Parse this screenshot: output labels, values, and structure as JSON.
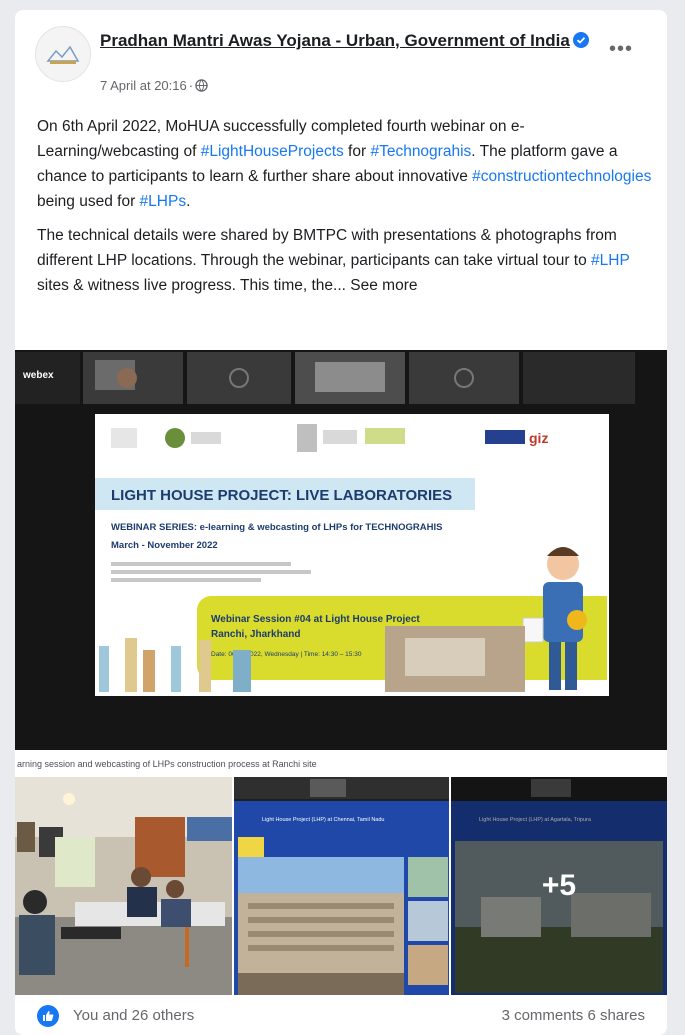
{
  "post": {
    "page_name": "Pradhan Mantri Awas Yojana - Urban, Government of India",
    "timestamp": "7 April at 20:16",
    "paragraphs": [
      [
        {
          "t": "On 6th April 2022, MoHUA successfully completed fourth webinar on e-Learning/webcasting of ",
          "tag": false
        },
        {
          "t": "#LightHouseProjects",
          "tag": true
        },
        {
          "t": " for ",
          "tag": false
        },
        {
          "t": "#Technograhis",
          "tag": true
        },
        {
          "t": ". The platform gave a chance to participants to learn & further share about innovative ",
          "tag": false
        },
        {
          "t": "#constructiontechnologies",
          "tag": true
        },
        {
          "t": " being used for ",
          "tag": false
        },
        {
          "t": "#LHPs",
          "tag": true
        },
        {
          "t": ".",
          "tag": false
        }
      ],
      [
        {
          "t": "The technical details were shared by BMTPC with presentations & photographs from different LHP locations. Through the webinar, participants can take virtual tour to ",
          "tag": false
        },
        {
          "t": "#LHP",
          "tag": true
        },
        {
          "t": " sites & witness live progress. This time, the... ",
          "tag": false
        }
      ]
    ],
    "see_more": "See more"
  },
  "main_photo": {
    "webex_label": "webex",
    "slide_title": "LIGHT HOUSE PROJECT: LIVE LABORATORIES",
    "slide_subtitle_1": "WEBINAR SERIES: e-learning & webcasting of LHPs for TECHNOGRAHIS",
    "slide_subtitle_2": "March - November 2022",
    "session_line_1": "Webinar Session #04 at Light House Project",
    "session_line_2": "Ranchi, Jharkhand",
    "session_date": "Date: 06.04.2022, Wednesday | Time: 14:30 – 15:30",
    "partner_logo": "giz"
  },
  "caption": "arning session and webcasting of LHPs construction process at Ranchi site",
  "thumbs": [
    {
      "title": ""
    },
    {
      "title": "Light House Project (LHP) at Chennai, Tamil Nadu"
    },
    {
      "title": "Light House Project (LHP) at Agartala, Tripura",
      "more": "+5"
    }
  ],
  "footer": {
    "reactions": "You and 26 others",
    "comments": "3 comments",
    "shares": "6 shares"
  },
  "colors": {
    "link": "#1877f2",
    "accent_yellow": "#d9dc2c",
    "slide_banner": "#cfe7f2"
  }
}
